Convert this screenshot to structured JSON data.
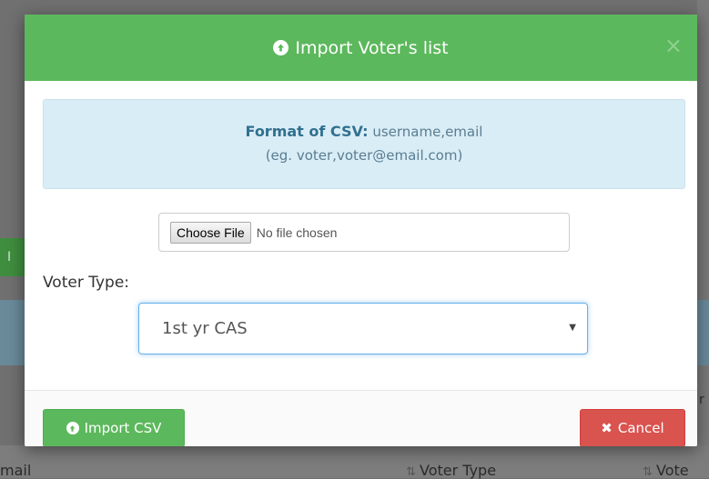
{
  "modal": {
    "title": "Import Voter's list",
    "close_glyph": "×",
    "title_icon": "circle-arrow-up-icon"
  },
  "info": {
    "format_label": "Format of CSV:",
    "format_value": "username,email",
    "example": "(eg. voter,voter@email.com)"
  },
  "file_input": {
    "button_label": "Choose File",
    "status": "No file chosen"
  },
  "voter_type": {
    "label": "Voter Type:",
    "selected": "1st yr CAS"
  },
  "footer": {
    "import_label": "Import CSV",
    "cancel_label": "Cancel"
  },
  "background": {
    "green_button_fragment": "I",
    "right_fragment": "r",
    "col_email": "mail",
    "col_voter_type": "Voter Type",
    "col_vote": "Vote"
  },
  "colors": {
    "header_green": "#5cb85c",
    "info_blue": "#d9edf7",
    "cancel_red": "#d9534f"
  }
}
